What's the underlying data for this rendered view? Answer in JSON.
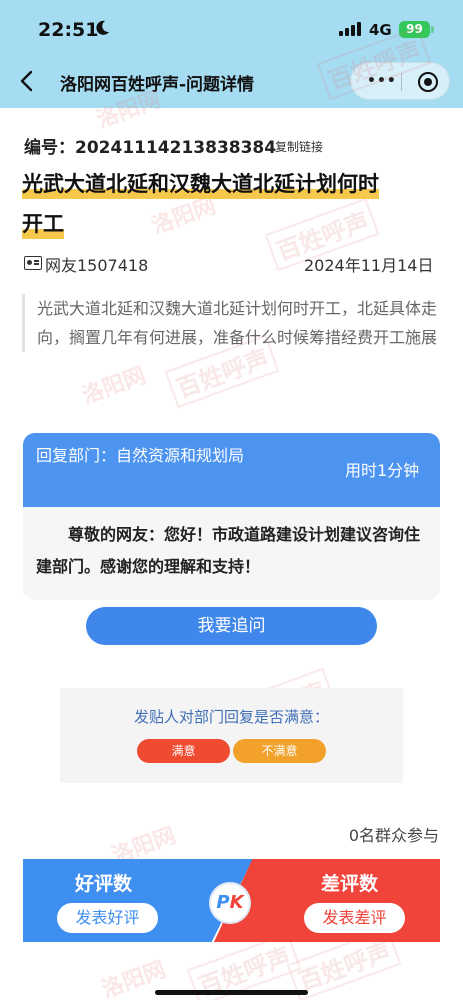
{
  "status_bar": {
    "time": "22:51",
    "network": "4G",
    "battery": "99"
  },
  "nav": {
    "title": "洛阳网百姓呼声-问题详情",
    "more_glyph": "•••"
  },
  "post": {
    "number": "编号：20241114213838384",
    "copy_link": "复制链接",
    "title_line1": "光武大道北延和汉魏大道北延计划何时",
    "title_line2": "开工",
    "author": "网友1507418",
    "date": "2024年11月14日",
    "content": "光武大道北延和汉魏大道北延计划何时开工，北延具体走向，搁置几年有何进展，准备什么时候筹措经费开工施展"
  },
  "reply": {
    "department": "回复部门：自然资源和规划局",
    "time_used": "用时1分钟",
    "body": "尊敬的网友：您好！市政道路建设计划建议咨询住建部门。感谢您的理解和支持！"
  },
  "actions": {
    "follow_up": "我要追问"
  },
  "satisfaction": {
    "question": "发贴人对部门回复是否满意：",
    "yes": "满意",
    "no": "不满意"
  },
  "participants": "0名群众参与",
  "pk": {
    "good_label": "好评数",
    "good_button": "发表好评",
    "bad_label": "差评数",
    "bad_button": "发表差评",
    "badge_p": "P",
    "badge_k": "K"
  },
  "watermarks": [
    "洛阳网",
    "百姓呼声"
  ],
  "colors": {
    "header_bg": "#a6dcf2",
    "primary_blue": "#4d94f0",
    "title_highlight": "#f6c94d",
    "satisfied_red": "#ef4b31",
    "unsatisfied_orange": "#f2a12a",
    "bad_red": "#f0433a",
    "battery_green": "#34c759"
  }
}
